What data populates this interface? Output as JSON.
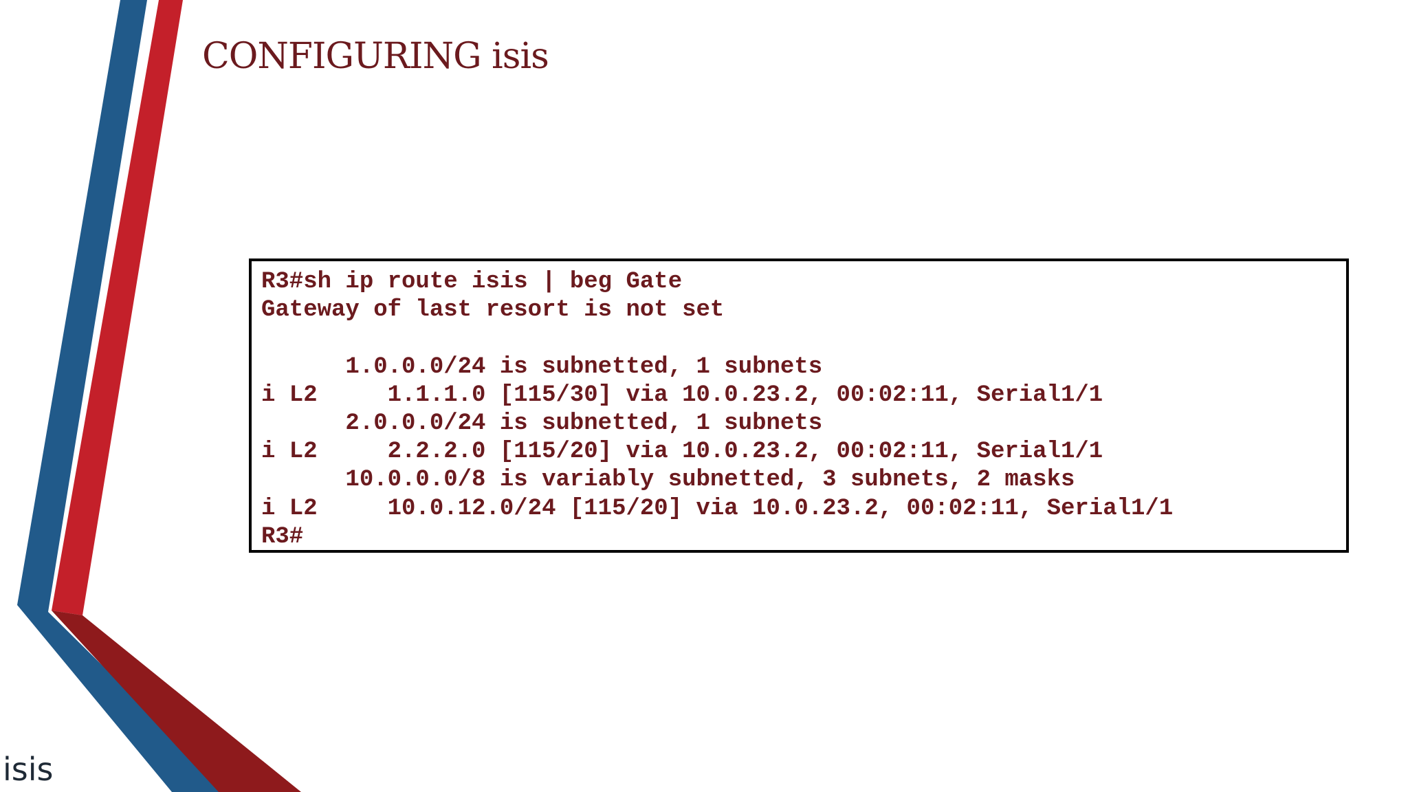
{
  "slide": {
    "title": "CONFIGURING isis",
    "footer_label": "isis"
  },
  "terminal": {
    "lines": [
      "R3#sh ip route isis | beg Gate",
      "Gateway of last resort is not set",
      "",
      "      1.0.0.0/24 is subnetted, 1 subnets",
      "i L2     1.1.1.0 [115/30] via 10.0.23.2, 00:02:11, Serial1/1",
      "      2.0.0.0/24 is subnetted, 1 subnets",
      "i L2     2.2.2.0 [115/20] via 10.0.23.2, 00:02:11, Serial1/1",
      "      10.0.0.0/8 is variably subnetted, 3 subnets, 2 masks",
      "i L2     10.0.12.0/24 [115/20] via 10.0.23.2, 00:02:11, Serial1/1",
      "R3#"
    ]
  },
  "colors": {
    "text_accent": "#6b1a1e",
    "stripe_blue": "#215a8a",
    "stripe_red": "#c4202a",
    "stripe_dark_red": "#8e1a1c"
  }
}
